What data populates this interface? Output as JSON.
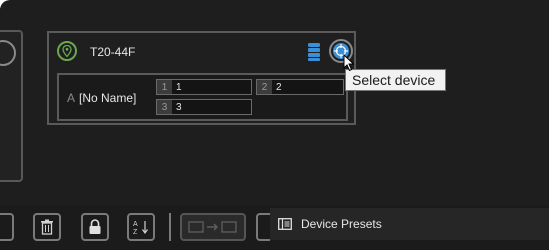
{
  "device": {
    "name": "T20-44F",
    "channel_letter": "A",
    "channel_label": "[No Name]",
    "slots": [
      {
        "num": "1",
        "value": "1"
      },
      {
        "num": "2",
        "value": "2"
      },
      {
        "num": "3",
        "value": "3"
      }
    ]
  },
  "tooltip": {
    "text": "Select device"
  },
  "presets": {
    "label": "Device Presets"
  },
  "icons": {
    "location": "map-pin-icon",
    "database": "database-icon",
    "target": "crosshair-icon",
    "delete": "trash-icon",
    "lock": "lock-icon",
    "sort": "sort-az-icon",
    "move": "move-icon",
    "presets": "presets-icon"
  },
  "colors": {
    "accent": "#3a8fd6",
    "pin": "#6aa84f"
  }
}
